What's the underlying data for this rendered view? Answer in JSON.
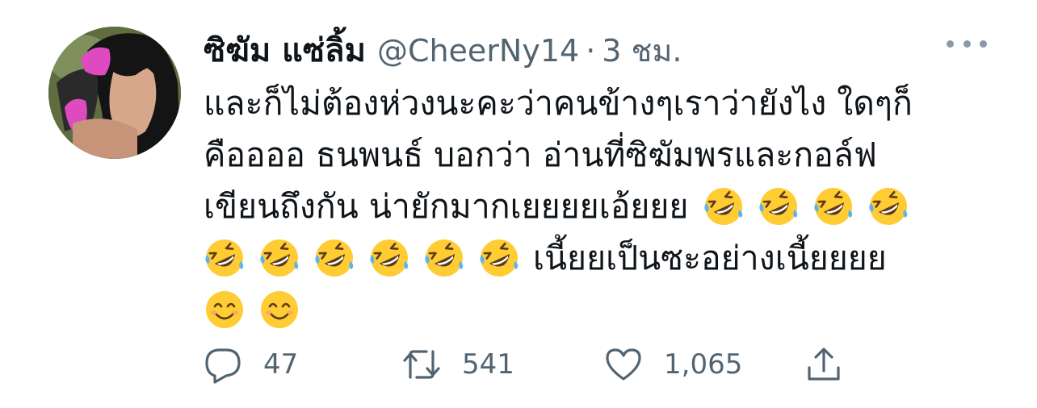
{
  "tweet": {
    "author": {
      "display_name": "ซิฆัม แซ่ลิ้ม",
      "handle": "@CheerNy14",
      "separator": "·",
      "time": "3 ชม."
    },
    "text_lines": [
      {
        "segments": [
          "และก็ไม่ต้องห่วงนะคะว่าคนข้างๆเราว่ายังไง ใดๆก็"
        ]
      },
      {
        "segments": [
          "คืออออ ธนพนธ์ บอกว่า อ่านที่ซิฆัมพรและกอล์ฟ"
        ]
      },
      {
        "segments": [
          "เขียนถึงกัน น่ายักมากเยยยยเอ้ยยย"
        ]
      },
      {
        "segments": [
          "เนี้ยยเป็นซะอย่างเนี้ยยยย"
        ]
      }
    ],
    "emojis": {
      "line3": [
        "rolling-on-floor-laughing",
        "rolling-on-floor-laughing",
        "rolling-on-floor-laughing",
        "rolling-on-floor-laughing"
      ],
      "line4": [
        "rolling-on-floor-laughing",
        "rolling-on-floor-laughing",
        "rolling-on-floor-laughing",
        "rolling-on-floor-laughing",
        "rolling-on-floor-laughing",
        "rolling-on-floor-laughing"
      ],
      "line5": [
        "smiling-face",
        "smiling-face"
      ]
    },
    "actions": {
      "reply_count": "47",
      "retweet_count": "541",
      "like_count": "1,065",
      "icons": [
        "reply-icon",
        "retweet-icon",
        "like-icon",
        "share-icon"
      ]
    },
    "colors": {
      "text": "#0f1419",
      "secondary": "#536471",
      "emoji_face": "#ffcc33"
    }
  }
}
